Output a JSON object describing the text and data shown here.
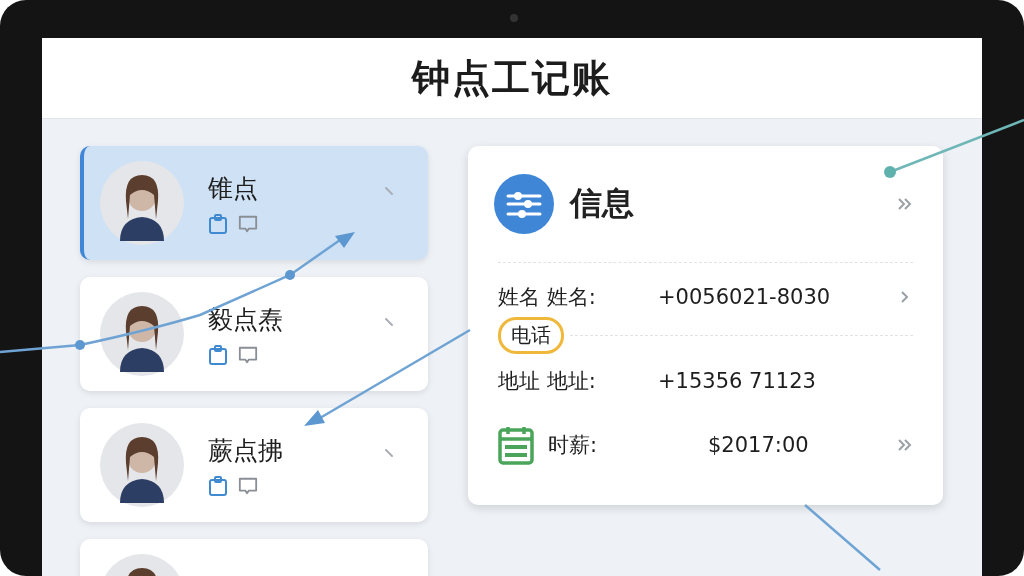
{
  "app": {
    "title": "钟点工记账"
  },
  "workers": [
    {
      "name": "锥点",
      "selected": true
    },
    {
      "name": "毅点焘",
      "selected": false
    },
    {
      "name": "蕨点拂",
      "selected": false
    },
    {
      "selected": false
    }
  ],
  "info": {
    "title": "信息",
    "tag": "电话",
    "rows": [
      {
        "kind": "field",
        "label": "姓名 姓名:",
        "value": "+0056021-8030"
      },
      {
        "kind": "plain",
        "label": "地址 地址:",
        "value": "+15356 71123"
      },
      {
        "kind": "wage",
        "label": "时薪:",
        "value": "$2017:00"
      }
    ]
  }
}
